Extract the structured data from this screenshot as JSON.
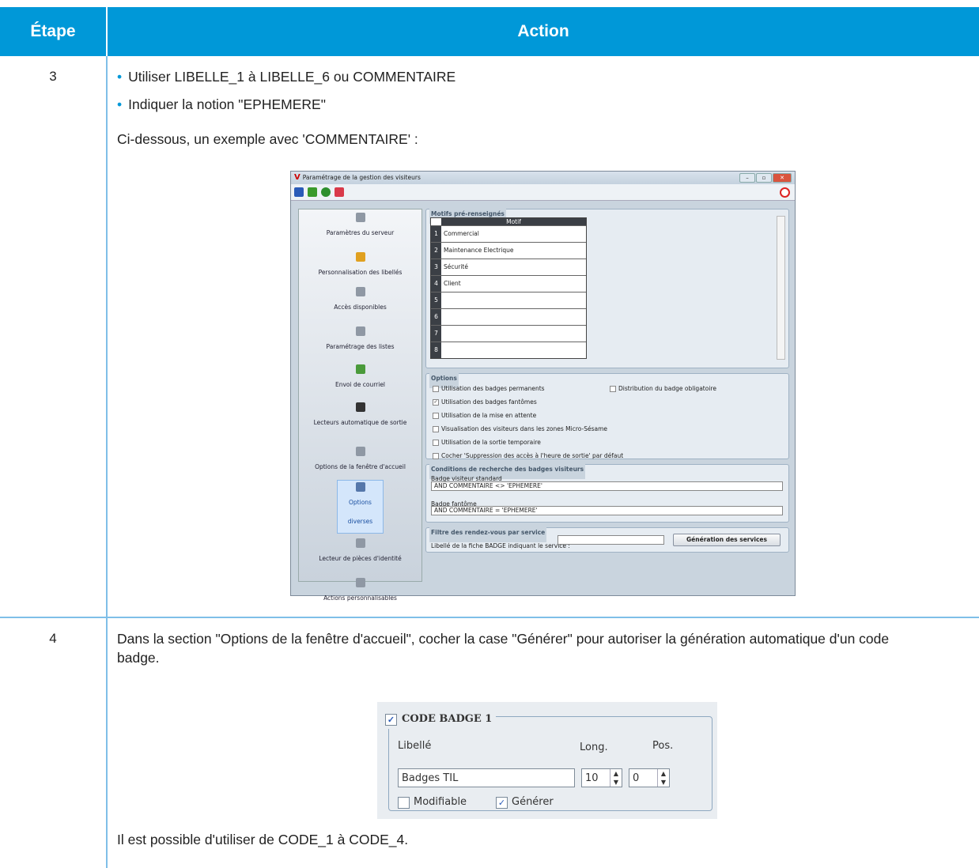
{
  "table": {
    "col_step": "Étape",
    "col_action": "Action"
  },
  "step3": {
    "number": "3",
    "bullets": [
      "Utiliser LIBELLE_1 à LIBELLE_6 ou COMMENTAIRE",
      "Indiquer la notion \"EPHEMERE\""
    ],
    "intro": "Ci-dessous, un exemple avec 'COMMENTAIRE' :",
    "window": {
      "title": "Paramétrage de la gestion des visiteurs",
      "sidebar": [
        "Paramètres du serveur",
        "Personnalisation des libellés",
        "Accès disponibles",
        "Paramétrage des listes",
        "Envoi de courriel",
        "Lecteurs automatique de sortie",
        "Options de la fenêtre d'accueil",
        "Options diverses",
        "Lecteur de pièces d'identité",
        "Actions personnalisables"
      ],
      "selected": "Options diverses",
      "motifs_title": "Motifs pré-renseignés",
      "motif_header": "Motif",
      "motifs": [
        {
          "n": "1",
          "v": "Commercial"
        },
        {
          "n": "2",
          "v": "Maintenance Electrique"
        },
        {
          "n": "3",
          "v": "Sécurité"
        },
        {
          "n": "4",
          "v": "Client"
        },
        {
          "n": "5",
          "v": ""
        },
        {
          "n": "6",
          "v": ""
        },
        {
          "n": "7",
          "v": ""
        },
        {
          "n": "8",
          "v": ""
        }
      ],
      "options_title": "Options",
      "options": [
        {
          "label": "Utilisation des badges permanents",
          "checked": false
        },
        {
          "label": "Utilisation des badges fantômes",
          "checked": true
        },
        {
          "label": "Utilisation de la mise en attente",
          "checked": false
        },
        {
          "label": "Visualisation des visiteurs dans les zones Micro-Sésame",
          "checked": false
        },
        {
          "label": "Utilisation de la sortie temporaire",
          "checked": false
        },
        {
          "label": "Cocher 'Suppression des accès à l'heure de sortie' par défaut",
          "checked": false
        }
      ],
      "option_right": "Distribution du badge obligatoire",
      "cond_title": "Conditions de recherche des badges visiteurs",
      "badge_std_label": "Badge visiteur standard",
      "badge_std_value": "AND COMMENTAIRE <> 'EPHEMERE'",
      "badge_ghost_label": "Badge fantôme",
      "badge_ghost_value": "AND COMMENTAIRE = 'EPHEMERE'",
      "filtre_title": "Filtre des rendez-vous par service",
      "filtre_label": "Libellé de la fiche BADGE indiquant le service :",
      "gen_button": "Génération des services"
    }
  },
  "step4": {
    "number": "4",
    "text": "Dans la section \"Options de la fenêtre d'accueil\", cocher la case \"Générer\" pour autoriser la génération automatique d'un code badge.",
    "badge": {
      "title": "CODE BADGE 1",
      "libelle_label": "Libellé",
      "long_label": "Long.",
      "pos_label": "Pos.",
      "libelle_value": "Badges TIL",
      "long_value": "10",
      "pos_value": "0",
      "modifiable": "Modifiable",
      "generer": "Générer"
    },
    "footer": "Il est possible d'utiliser de CODE_1 à CODE_4."
  },
  "colors": {
    "header_bg": "#0098d8",
    "border": "#7fbfe8"
  }
}
